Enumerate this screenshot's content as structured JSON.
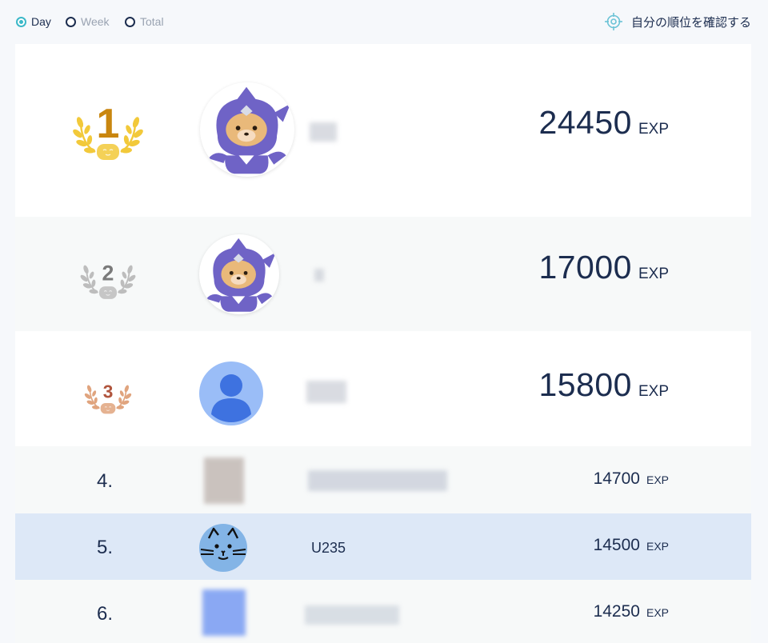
{
  "filters": {
    "day": "Day",
    "week": "Week",
    "total": "Total",
    "selected": "Day"
  },
  "check_rank_label": "自分の順位を確認する",
  "icons": {
    "check_rank": "crosshair-target-icon",
    "rank1": "gold-laurel-medal-icon",
    "rank2": "silver-laurel-medal-icon",
    "rank3": "bronze-laurel-medal-icon",
    "default_avatar": "user-silhouette-icon",
    "cat_avatar": "cat-face-icon",
    "mascot_avatar": "ninja-bear-mascot-icon"
  },
  "colors": {
    "accent": "#3bb8c8",
    "text": "#1c2d4f",
    "gold": "#c9860f",
    "silver": "#8a8a8a",
    "bronze": "#b0553d",
    "highlight_row": "#dde8f7"
  },
  "ranking": [
    {
      "medal_rank": "1",
      "score": "24450",
      "unit": "EXP"
    },
    {
      "medal_rank": "2",
      "score": "17000",
      "unit": "EXP"
    },
    {
      "medal_rank": "3",
      "score": "15800",
      "unit": "EXP"
    },
    {
      "rank": "4.",
      "score": "14700",
      "unit": "EXP"
    },
    {
      "rank": "5.",
      "name": "U235",
      "score": "14500",
      "unit": "EXP"
    },
    {
      "rank": "6.",
      "score": "14250",
      "unit": "EXP"
    }
  ]
}
